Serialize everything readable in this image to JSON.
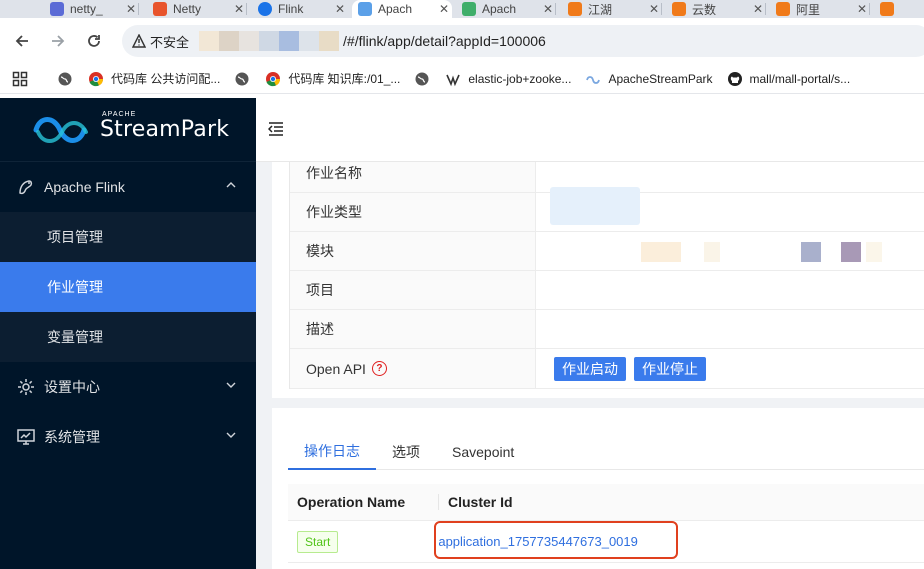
{
  "browser": {
    "tabs": [
      {
        "label": "netty_",
        "active": false,
        "color": "#5b6bd6"
      },
      {
        "label": "Netty",
        "active": false,
        "color": "#e8542c"
      },
      {
        "label": "Flink",
        "active": false,
        "color": "#1a73e8"
      },
      {
        "label": "Apach",
        "active": true,
        "color": "#5ba0e8"
      },
      {
        "label": "Apach",
        "active": false,
        "color": "#3fae6a"
      },
      {
        "label": "江湖",
        "active": false,
        "color": "#f07a1a"
      },
      {
        "label": "云数",
        "active": false,
        "color": "#f07a1a"
      },
      {
        "label": "阿里",
        "active": false,
        "color": "#f07a1a"
      },
      {
        "label": "",
        "active": false,
        "color": "#f07a1a"
      }
    ],
    "security_label": "不安全",
    "url_path": "/#/flink/app/detail?appId=100006",
    "bookmarks": [
      {
        "label": "",
        "icon": "apps-grid-icon"
      },
      {
        "label": "",
        "icon": "globe-icon"
      },
      {
        "label": "代码库 公共访问配...",
        "icon": "chrome-icon"
      },
      {
        "label": "",
        "icon": "globe-icon"
      },
      {
        "label": "代码库 知识库:/01_...",
        "icon": "chrome-icon"
      },
      {
        "label": "",
        "icon": "globe-icon"
      },
      {
        "label": "elastic-job+zooke...",
        "icon": "elastic-icon"
      },
      {
        "label": "ApacheStreamPark",
        "icon": "streampark-icon"
      },
      {
        "label": "mall/mall-portal/s...",
        "icon": "github-icon"
      }
    ]
  },
  "logo": {
    "apache": "APACHE",
    "name": "StreamPark"
  },
  "sidebar": {
    "items": [
      {
        "label": "Apache Flink",
        "icon": "flink-icon",
        "expanded": true,
        "children": [
          {
            "label": "项目管理",
            "selected": false
          },
          {
            "label": "作业管理",
            "selected": true
          },
          {
            "label": "变量管理",
            "selected": false
          }
        ]
      },
      {
        "label": "设置中心",
        "icon": "gear-icon",
        "expanded": false
      },
      {
        "label": "系统管理",
        "icon": "monitor-icon",
        "expanded": false
      }
    ]
  },
  "detail": {
    "rows": [
      {
        "label": "作业名称"
      },
      {
        "label": "作业类型"
      },
      {
        "label": "模块"
      },
      {
        "label": "项目"
      },
      {
        "label": "描述"
      },
      {
        "label": "Open API"
      }
    ],
    "api_buttons": [
      "作业启动",
      "作业停止"
    ]
  },
  "tabs": [
    "操作日志",
    "选项",
    "Savepoint"
  ],
  "table": {
    "headers": [
      "Operation Name",
      "Cluster Id"
    ],
    "rows": [
      {
        "operation": "Start",
        "cluster_id": "application_1757735447673_0019"
      }
    ]
  },
  "colors": {
    "sidebar_bg": "#001529",
    "accent": "#3a7bec",
    "highlight": "#e0401e"
  }
}
